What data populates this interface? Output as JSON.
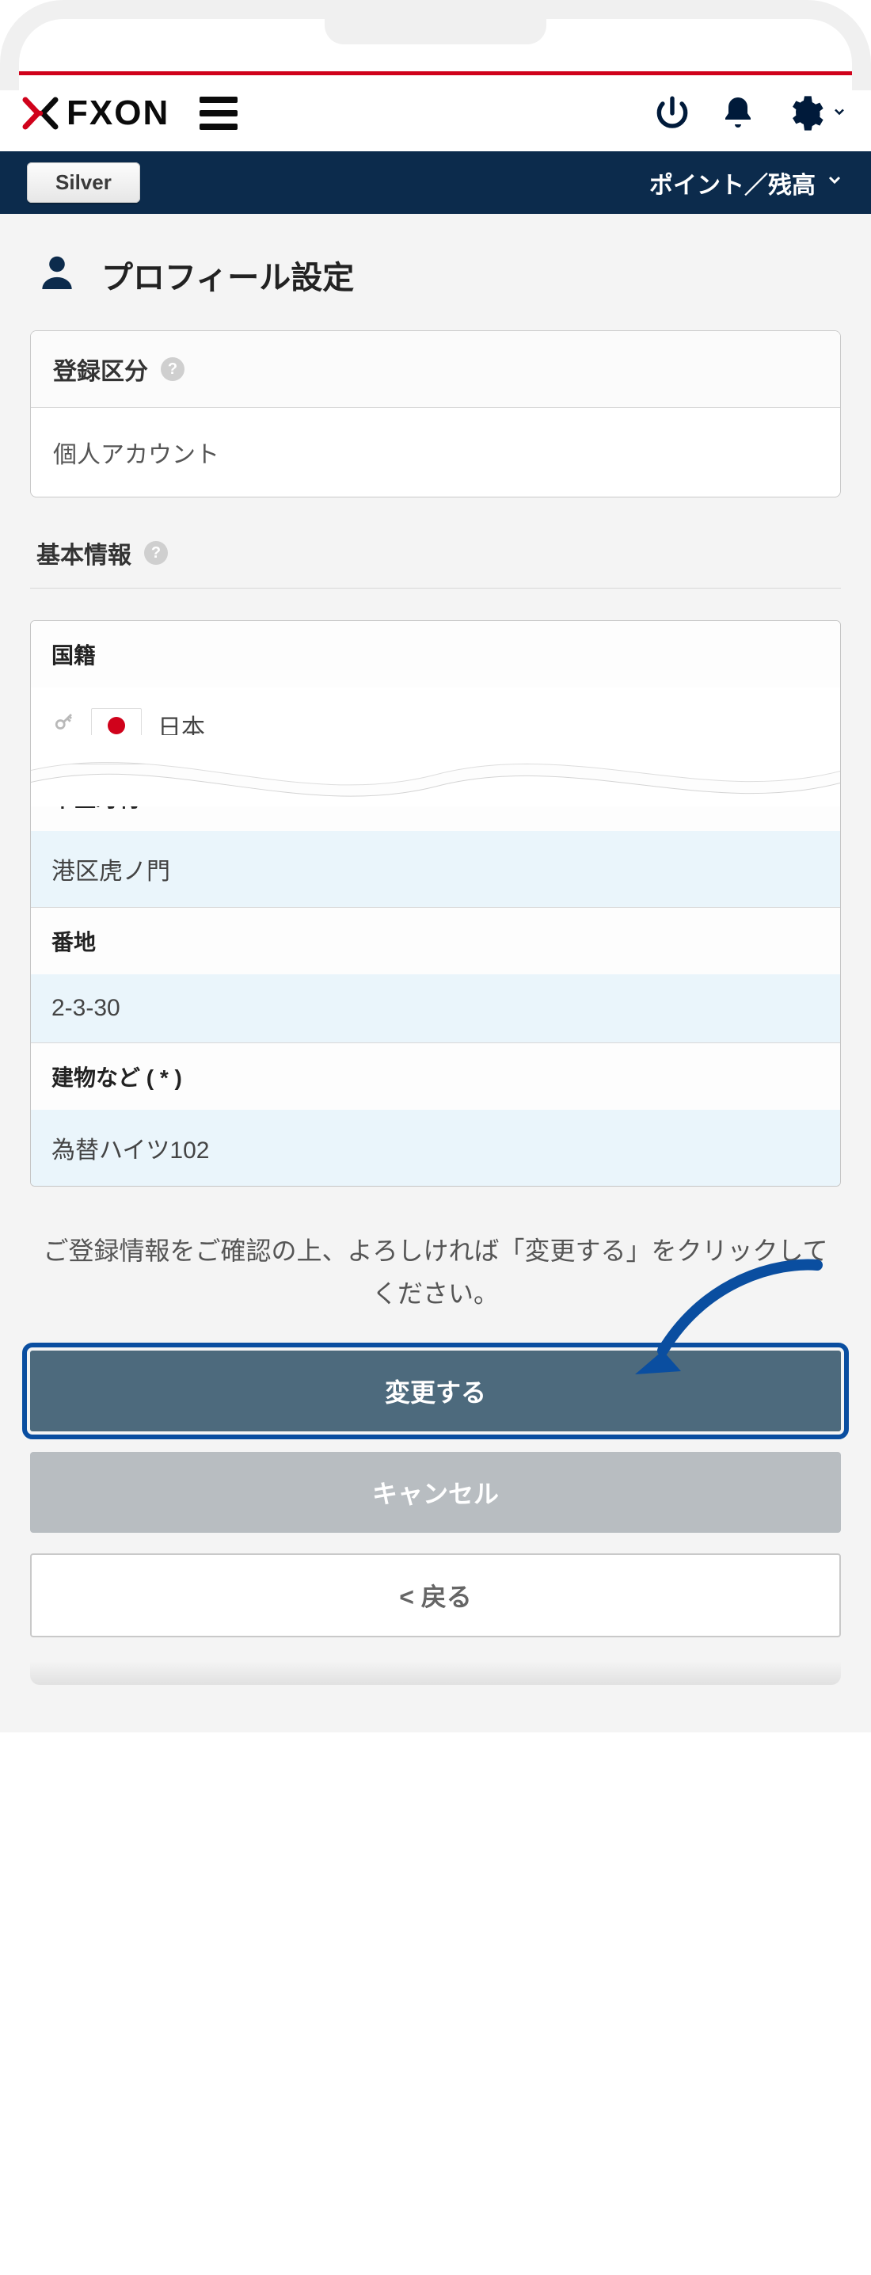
{
  "header": {
    "brand_text": "FXON",
    "tier": "Silver",
    "points_label": "ポイント／残高"
  },
  "page": {
    "title": "プロフィール設定"
  },
  "reg": {
    "label": "登録区分",
    "value": "個人アカウント"
  },
  "basic": {
    "title": "基本情報",
    "fields": {
      "nationality": {
        "label": "国籍",
        "value": "日本"
      },
      "city": {
        "label": "市区町村",
        "value": "港区虎ノ門"
      },
      "street": {
        "label": "番地",
        "value": "2-3-30"
      },
      "building": {
        "label": "建物など ( * )",
        "value": "為替ハイツ102"
      }
    }
  },
  "confirm_text": "ご登録情報をご確認の上、よろしければ「変更する」をクリックしてください。",
  "buttons": {
    "submit": "変更する",
    "cancel": "キャンセル",
    "back": "<  戻る"
  }
}
